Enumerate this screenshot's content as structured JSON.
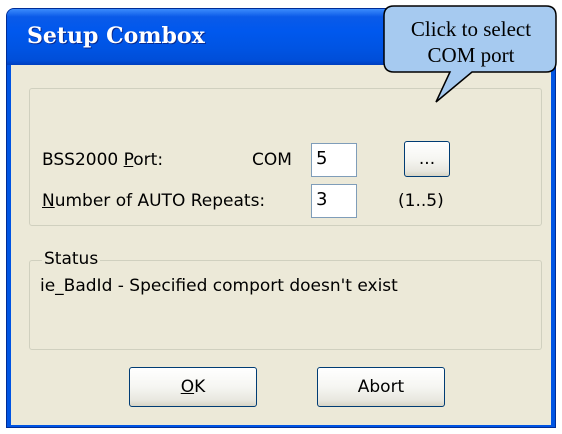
{
  "window": {
    "title": "Setup Combox"
  },
  "settings": {
    "port_label_prefix": "BSS2000 ",
    "port_label_mnemonic": "P",
    "port_label_suffix": "ort:",
    "com_label": "COM",
    "com_value": "5",
    "browse_label": "...",
    "repeats_label_mnemonic": "N",
    "repeats_label_suffix": "umber of AUTO Repeats:",
    "repeats_value": "3",
    "repeats_range": "(1..5)"
  },
  "status": {
    "group_label": "Status",
    "message": "ie_BadId - Specified comport doesn't exist"
  },
  "buttons": {
    "ok_mnemonic": "O",
    "ok_suffix": "K",
    "abort_label": "Abort"
  },
  "callout": {
    "line1": "Click to select",
    "line2": "COM port",
    "fill_color": "#a6caf0",
    "border_color": "#000000"
  },
  "colors": {
    "titlebar": "#0054e3",
    "dialog_face": "#ece9d8",
    "button_border": "#003c74",
    "textbox_border": "#7f9db9"
  }
}
